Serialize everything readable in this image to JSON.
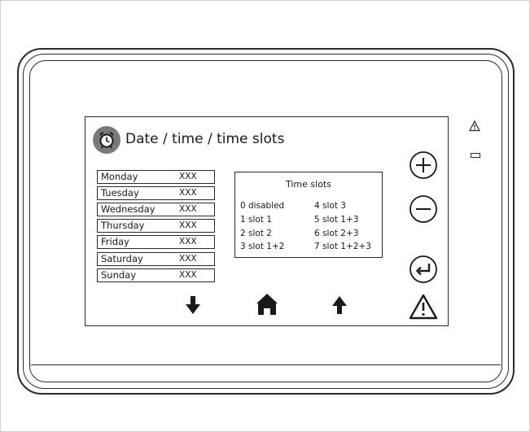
{
  "header": {
    "title": "Date / time / time slots"
  },
  "schedule": {
    "days": [
      {
        "name": "Monday",
        "value": "XXX"
      },
      {
        "name": "Tuesday",
        "value": "XXX"
      },
      {
        "name": "Wednesday",
        "value": "XXX"
      },
      {
        "name": "Thursday",
        "value": "XXX"
      },
      {
        "name": "Friday",
        "value": "XXX"
      },
      {
        "name": "Saturday",
        "value": "XXX"
      },
      {
        "name": "Sunday",
        "value": "XXX"
      }
    ]
  },
  "time_slots": {
    "title": "Time slots",
    "items": [
      "0 disabled",
      "1 slot 1",
      "2 slot 2",
      "3 slot 1+2",
      "4 slot 3",
      "5 slot 1+3",
      "6 slot 2+3",
      "7 slot 1+2+3"
    ]
  },
  "icons": {
    "title": "alarm-clock-icon",
    "controls": [
      "plus-icon",
      "minus-icon",
      "enter-icon",
      "warning-icon"
    ],
    "nav": [
      "arrow-down-icon",
      "home-icon",
      "arrow-up-icon"
    ]
  },
  "colors": {
    "icon_background": "#7a7a7a",
    "line": "#2a2a2a"
  }
}
